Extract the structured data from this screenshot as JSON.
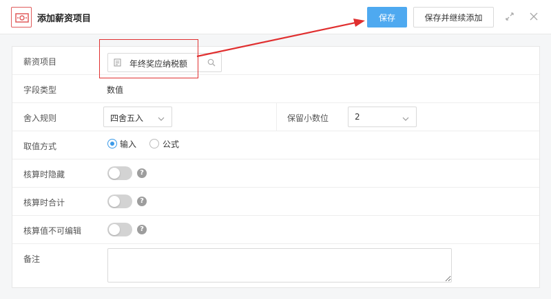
{
  "header": {
    "title": "添加薪资项目",
    "save_label": "保存",
    "save_continue_label": "保存并继续添加"
  },
  "form": {
    "salary_item": {
      "label": "薪资项目",
      "value": "年终奖应纳税额"
    },
    "field_type": {
      "label": "字段类型",
      "value": "数值"
    },
    "rounding": {
      "label": "舍入规则",
      "value": "四舍五入"
    },
    "decimal_places": {
      "label": "保留小数位",
      "value": "2"
    },
    "value_method": {
      "label": "取值方式",
      "option_input": "输入",
      "option_formula": "公式",
      "selected": "输入"
    },
    "hide_on_calc": {
      "label": "核算时隐藏",
      "help": "?"
    },
    "total_on_calc": {
      "label": "核算时合计",
      "help": "?"
    },
    "not_editable": {
      "label": "核算值不可编辑",
      "help": "?"
    },
    "remark": {
      "label": "备注",
      "value": ""
    }
  },
  "colors": {
    "primary": "#4ea9f0",
    "annotation_red": "#e02f2f",
    "radio_accent": "#3b9ae8"
  },
  "icons": [
    "money-icon",
    "document-icon",
    "search-icon",
    "chevron-down-icon",
    "expand-icon",
    "close-icon",
    "help-icon"
  ]
}
